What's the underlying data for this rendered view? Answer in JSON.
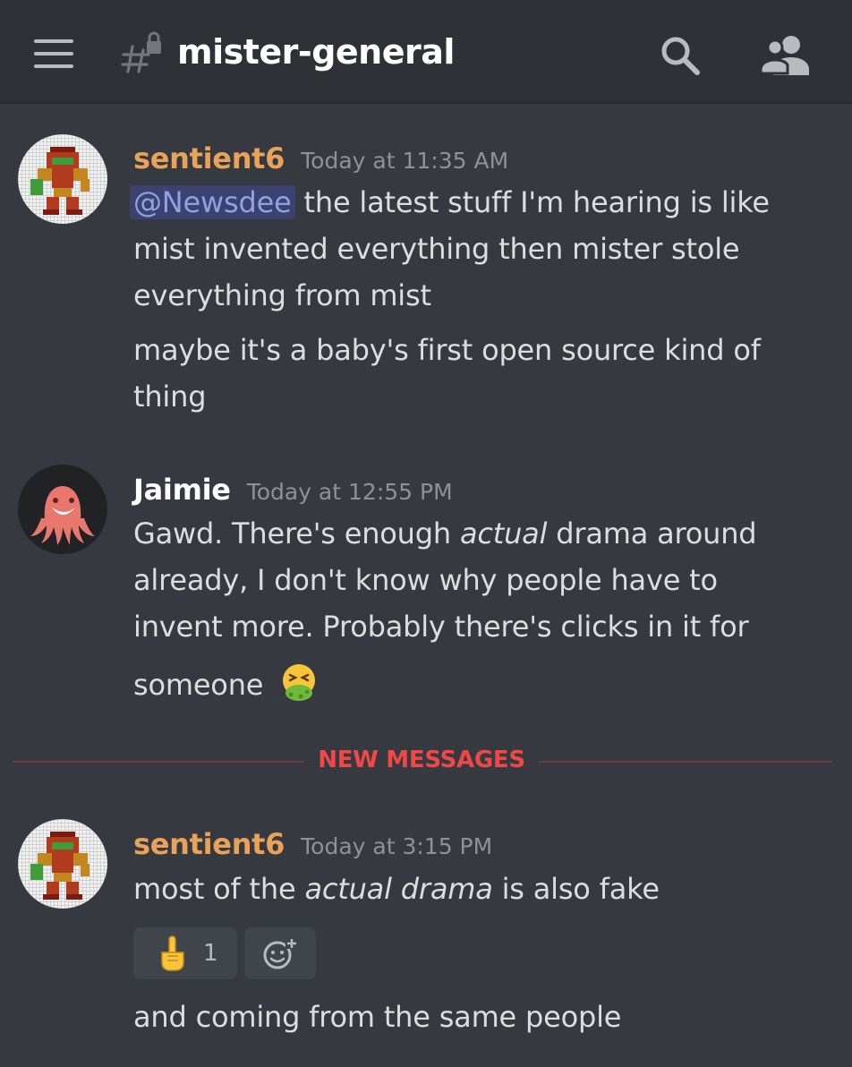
{
  "header": {
    "channel_name": "mister-general",
    "channel_icon": "locked-hash-icon",
    "menu_icon": "hamburger-menu-icon",
    "search_icon": "search-icon",
    "members_icon": "members-icon"
  },
  "messages": [
    {
      "author": "sentient6",
      "author_color": "#e8a25a",
      "timestamp": "Today at 11:35 AM",
      "avatar": "pixel-samus-avatar",
      "lines": [
        {
          "mention": "@Newsdee",
          "text": " the latest stuff I'm hearing is like"
        },
        {
          "text": "mist invented everything then mister stole"
        },
        {
          "text": "everything from mist"
        },
        {
          "text": "maybe it's a baby's first open source kind of"
        },
        {
          "text": "thing"
        }
      ]
    },
    {
      "author": "Jaimie",
      "author_color": "#ffffff",
      "timestamp": "Today at 12:55 PM",
      "avatar": "pink-octopus-avatar",
      "lines": [
        {
          "pre": "Gawd. There's enough ",
          "em": "actual",
          "post": " drama around"
        },
        {
          "text": "already, I don't know why people have to"
        },
        {
          "text": "invent more. Probably there's clicks in it for"
        },
        {
          "text": "someone",
          "emoji": "vomiting-face-emoji"
        }
      ]
    },
    {
      "author": "sentient6",
      "author_color": "#e8a25a",
      "timestamp": "Today at 3:15 PM",
      "avatar": "pixel-samus-avatar",
      "lines": [
        {
          "pre": "most of the ",
          "em": "actual drama",
          "post": " is also fake"
        },
        {
          "text": "and coming from the same people"
        }
      ],
      "reaction": {
        "emoji": "pointing-up-emoji",
        "count": "1"
      },
      "add_reaction_icon": "add-reaction-icon"
    }
  ],
  "divider": {
    "label": "NEW MESSAGES",
    "color": "#f04747"
  }
}
